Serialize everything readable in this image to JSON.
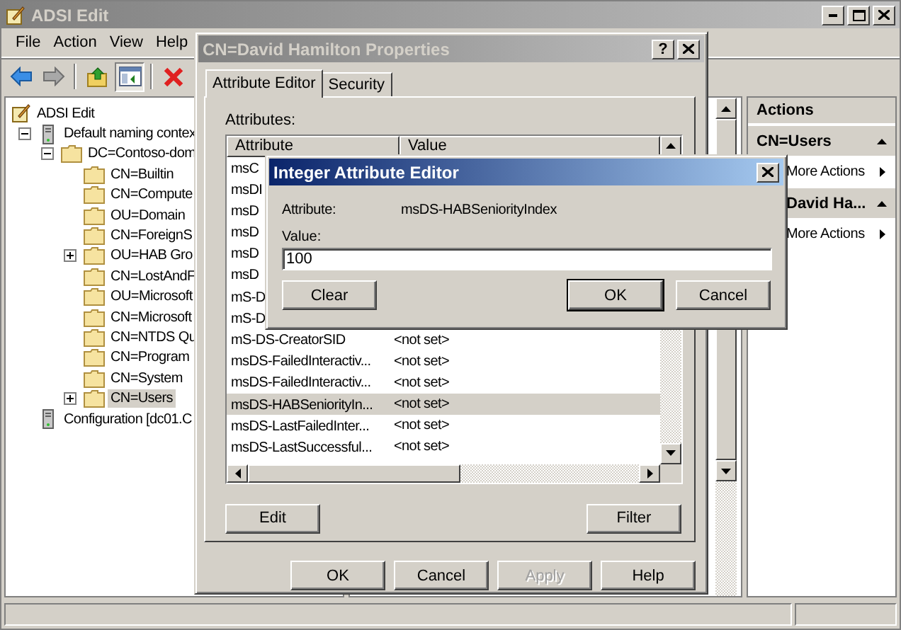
{
  "main_window": {
    "title": "ADSI Edit",
    "menu": [
      "File",
      "Action",
      "View",
      "Help"
    ]
  },
  "tree": [
    {
      "label": "ADSI Edit",
      "kind": "root",
      "selected": false,
      "children": [
        {
          "label": "Default naming contex",
          "kind": "server",
          "expanded": true,
          "selected": false,
          "children": [
            {
              "label": "DC=Contoso-dom",
              "kind": "folder",
              "expanded": true,
              "selected": false,
              "children": [
                {
                  "label": "CN=Builtin",
                  "kind": "folder",
                  "selected": false
                },
                {
                  "label": "CN=Compute",
                  "kind": "folder",
                  "selected": false
                },
                {
                  "label": "OU=Domain",
                  "kind": "folder",
                  "selected": false
                },
                {
                  "label": "CN=ForeignS",
                  "kind": "folder",
                  "selected": false
                },
                {
                  "label": "OU=HAB Gro",
                  "kind": "folder",
                  "expanded": false,
                  "selected": false
                },
                {
                  "label": "CN=LostAndF",
                  "kind": "folder",
                  "selected": false
                },
                {
                  "label": "OU=Microsoft",
                  "kind": "folder",
                  "selected": false
                },
                {
                  "label": "CN=Microsoft",
                  "kind": "folder",
                  "selected": false
                },
                {
                  "label": "CN=NTDS Qu",
                  "kind": "folder",
                  "selected": false
                },
                {
                  "label": "CN=Program",
                  "kind": "folder",
                  "selected": false
                },
                {
                  "label": "CN=System",
                  "kind": "folder",
                  "selected": false
                },
                {
                  "label": "CN=Users",
                  "kind": "folder",
                  "expanded": false,
                  "selected": true
                }
              ]
            }
          ]
        },
        {
          "label": "Configuration [dc01.C",
          "kind": "server",
          "selected": false
        }
      ]
    }
  ],
  "actions_pane": {
    "title": "Actions",
    "sections": [
      {
        "title": "CN=Users",
        "expanded": true,
        "items": [
          "More Actions"
        ]
      },
      {
        "title": "David Ha...",
        "expanded": true,
        "items": [
          "More Actions"
        ]
      }
    ]
  },
  "properties_dialog": {
    "title": "CN=David Hamilton Properties",
    "help_button": "?",
    "tabs": [
      {
        "label": "Attribute Editor",
        "selected": true
      },
      {
        "label": "Security",
        "selected": false
      }
    ],
    "attributes_label": "Attributes:",
    "columns": [
      "Attribute",
      "Value"
    ],
    "rows": [
      {
        "attribute": "msC",
        "selected": false
      },
      {
        "attribute": "msDI",
        "selected": false
      },
      {
        "attribute": "msD",
        "selected": false
      },
      {
        "attribute": "msD",
        "selected": false
      },
      {
        "attribute": "msD",
        "selected": false
      },
      {
        "attribute": "msD",
        "selected": false
      },
      {
        "attribute": "mS-D",
        "selected": false
      },
      {
        "attribute": "mS-D",
        "selected": false
      },
      {
        "attribute": "mS-DS-CreatorSID",
        "value": "<not set>",
        "selected": false
      },
      {
        "attribute": "msDS-FailedInteractiv...",
        "value": "<not set>",
        "selected": false
      },
      {
        "attribute": "msDS-FailedInteractiv...",
        "value": "<not set>",
        "selected": false
      },
      {
        "attribute": "msDS-HABSeniorityIn...",
        "value": "<not set>",
        "selected": true
      },
      {
        "attribute": "msDS-LastFailedInter...",
        "value": "<not set>",
        "selected": false
      },
      {
        "attribute": "msDS-LastSuccessful...",
        "value": "<not set>",
        "selected": false
      }
    ],
    "list_buttons": [
      "Edit",
      "Filter"
    ],
    "buttons": [
      {
        "label": "OK",
        "disabled": false
      },
      {
        "label": "Cancel",
        "disabled": false
      },
      {
        "label": "Apply",
        "disabled": true
      },
      {
        "label": "Help",
        "disabled": false
      }
    ]
  },
  "integer_editor": {
    "title": "Integer Attribute Editor",
    "attribute_label": "Attribute:",
    "attribute_name": "msDS-HABSeniorityIndex",
    "value_label": "Value:",
    "value": "100",
    "buttons": [
      {
        "label": "Clear",
        "default": false
      },
      {
        "label": "OK",
        "default": true
      },
      {
        "label": "Cancel",
        "default": false
      }
    ]
  }
}
